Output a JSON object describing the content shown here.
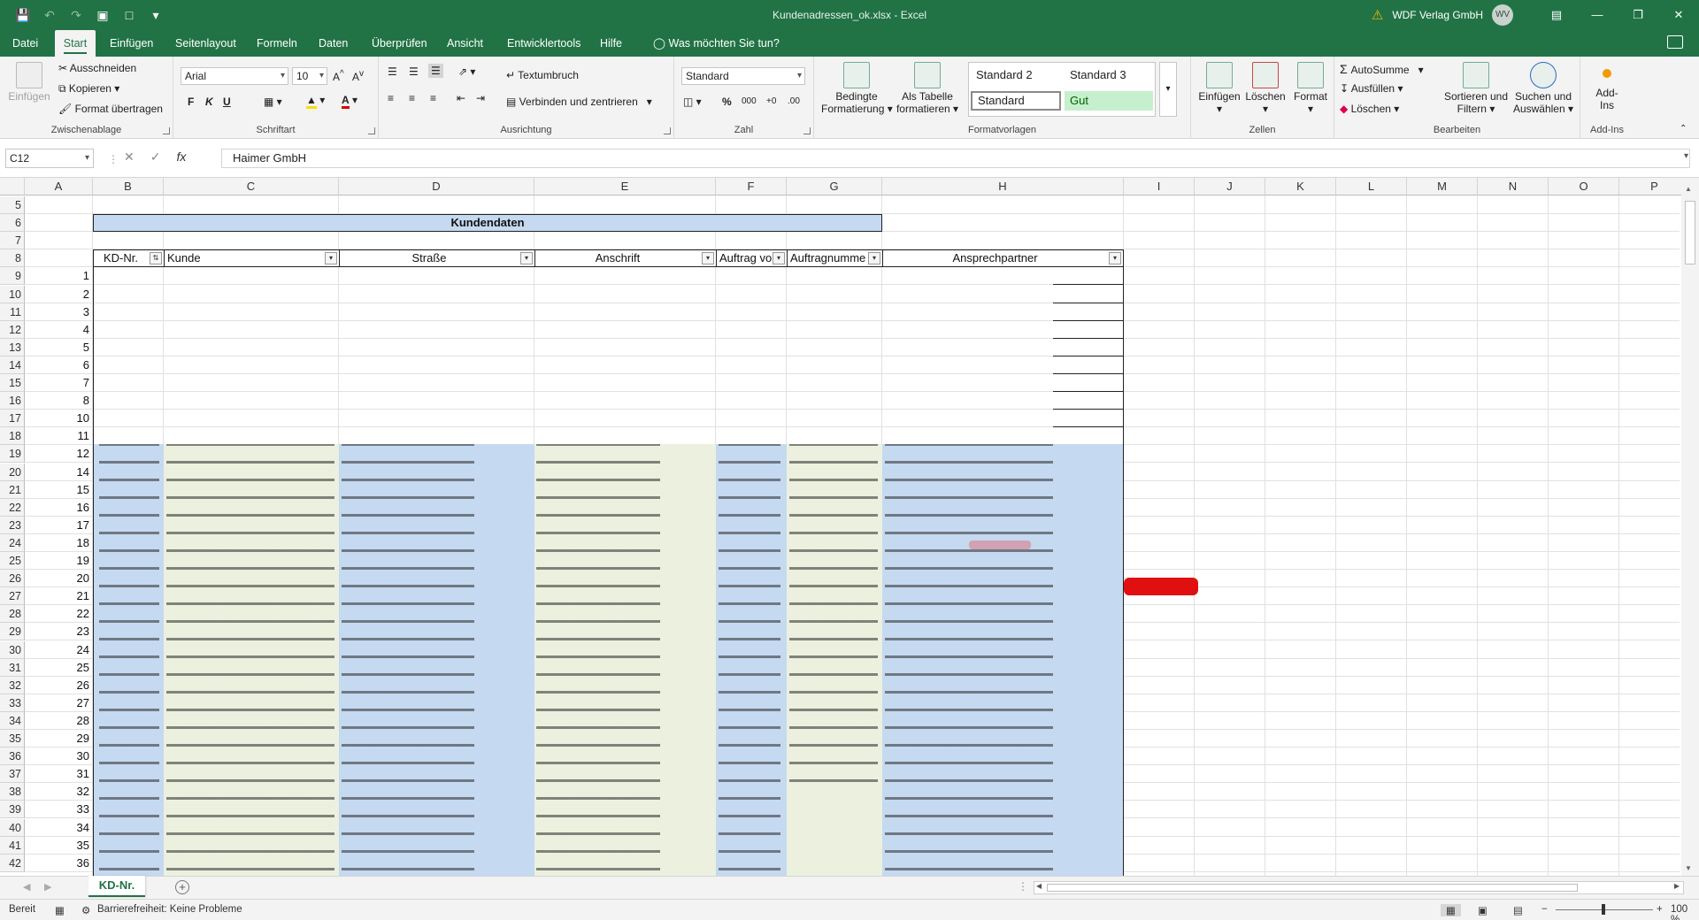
{
  "window": {
    "title": "Kundenadressen_ok.xlsx  -  Excel",
    "user": "WDF Verlag GmbH",
    "avatar_initials": "WV"
  },
  "qat_icons": [
    "save-icon",
    "undo-icon",
    "redo-icon",
    "screenshot-icon",
    "new-file-icon",
    "customize-icon"
  ],
  "menu": {
    "tabs": [
      "Datei",
      "Start",
      "Einfügen",
      "Seitenlayout",
      "Formeln",
      "Daten",
      "Überprüfen",
      "Ansicht",
      "Entwicklertools",
      "Hilfe"
    ],
    "active": "Start",
    "tell_me": "Was möchten Sie tun?"
  },
  "ribbon": {
    "clipboard": {
      "label": "Zwischenablage",
      "paste": "Einfügen",
      "cut": "Ausschneiden",
      "copy": "Kopieren",
      "format_painter": "Format übertragen"
    },
    "font": {
      "label": "Schriftart",
      "name": "Arial",
      "size": "10",
      "bold": "F",
      "italic": "K",
      "underline": "U"
    },
    "alignment": {
      "label": "Ausrichtung",
      "wrap": "Textumbruch",
      "merge": "Verbinden und zentrieren"
    },
    "number": {
      "label": "Zahl",
      "format": "Standard"
    },
    "styles": {
      "label": "Formatvorlagen",
      "conditional_1": "Bedingte",
      "conditional_2": "Formatierung",
      "as_table_1": "Als Tabelle",
      "as_table_2": "formatieren",
      "style_a": "Standard 2",
      "style_b": "Standard 3",
      "style_c": "Standard",
      "style_d": "Gut"
    },
    "cells": {
      "label": "Zellen",
      "insert": "Einfügen",
      "delete": "Löschen",
      "format": "Format"
    },
    "editing": {
      "label": "Bearbeiten",
      "autosum": "AutoSumme",
      "fill": "Ausfüllen",
      "clear": "Löschen",
      "sort_1": "Sortieren und",
      "sort_2": "Filtern",
      "find_1": "Suchen und",
      "find_2": "Auswählen"
    },
    "addins": {
      "label": "Add-Ins",
      "btn_1": "Add-",
      "btn_2": "Ins"
    }
  },
  "formula_bar": {
    "name_box": "C12",
    "fx": "fx",
    "content": "Haimer GmbH"
  },
  "sheet": {
    "columns": [
      "A",
      "B",
      "C",
      "D",
      "E",
      "F",
      "G",
      "H",
      "I",
      "J",
      "K",
      "L",
      "M",
      "N",
      "O",
      "P"
    ],
    "rows": [
      "5",
      "6",
      "7",
      "8",
      "9",
      "10",
      "11",
      "12",
      "13",
      "14",
      "15",
      "16",
      "17",
      "18",
      "19",
      "20",
      "21",
      "22",
      "23",
      "24",
      "25",
      "26",
      "27",
      "28",
      "29",
      "30",
      "31",
      "32",
      "33",
      "34",
      "35",
      "36",
      "37",
      "38",
      "39",
      "40",
      "41",
      "42"
    ],
    "title": "Kundendaten",
    "headers": [
      "KD-Nr.",
      "Kunde",
      "Straße",
      "Anschrift",
      "Auftrag vo",
      "Auftragnumme",
      "Ansprechpartner"
    ],
    "kd_numbers": [
      "1",
      "2",
      "3",
      "4",
      "5",
      "6",
      "7",
      "8",
      "10",
      "11",
      "12",
      "14",
      "15",
      "16",
      "17",
      "18",
      "19",
      "20",
      "21",
      "22",
      "23",
      "24",
      "25",
      "26",
      "27",
      "28",
      "29",
      "30",
      "31",
      "32",
      "33",
      "34",
      "35",
      "36"
    ]
  },
  "sheet_tabs": {
    "active": "KD-Nr."
  },
  "status": {
    "ready": "Bereit",
    "accessibility": "Barrierefreiheit: Keine Probleme",
    "zoom": "100 %"
  },
  "colors": {
    "excel_green": "#217346",
    "band_blue": "#c5d9f1",
    "band_green": "#ebf1de"
  }
}
